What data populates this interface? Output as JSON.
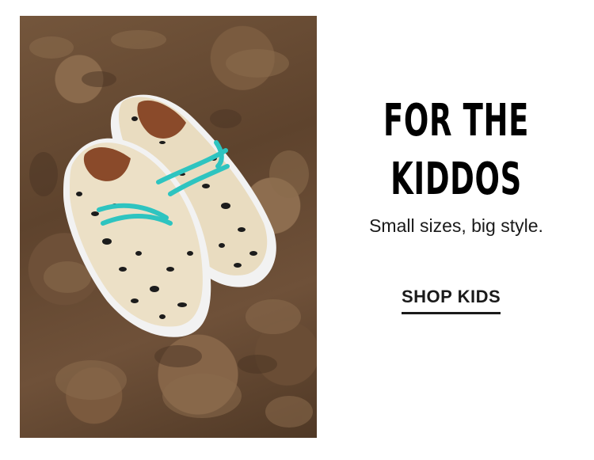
{
  "banner": {
    "heading_line1": "FOR THE",
    "heading_line2": "KIDDOS",
    "subtitle": "Small sizes, big style.",
    "cta_label": "SHOP KIDS"
  },
  "colors": {
    "text": "#000000",
    "laces": "#2ec4c0",
    "dirt": "#6f5139"
  },
  "image": {
    "subject": "kids-shoes-photo"
  }
}
